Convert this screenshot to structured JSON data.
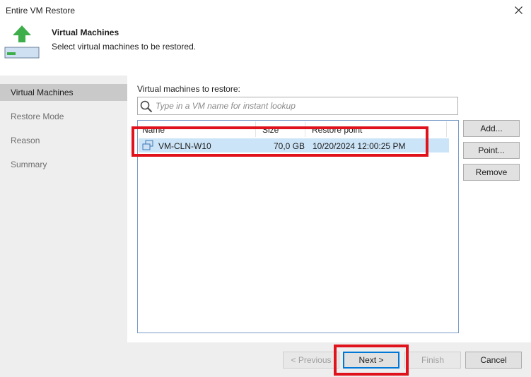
{
  "window": {
    "title": "Entire VM Restore"
  },
  "header": {
    "title": "Virtual Machines",
    "subtitle": "Select virtual machines to be restored."
  },
  "sidebar": {
    "items": [
      {
        "label": "Virtual Machines",
        "active": true
      },
      {
        "label": "Restore Mode",
        "active": false
      },
      {
        "label": "Reason",
        "active": false
      },
      {
        "label": "Summary",
        "active": false
      }
    ]
  },
  "main": {
    "section_label": "Virtual machines to restore:",
    "search": {
      "placeholder": "Type in a VM name for instant lookup",
      "value": ""
    },
    "table": {
      "columns": [
        "Name",
        "Size",
        "Restore point"
      ],
      "rows": [
        {
          "name": "VM-CLN-W10",
          "size": "70,0 GB",
          "restore_point": "10/20/2024 12:00:25 PM",
          "selected": true
        }
      ]
    },
    "side_buttons": {
      "add": "Add...",
      "point": "Point...",
      "remove": "Remove"
    }
  },
  "footer": {
    "previous": "< Previous",
    "next": "Next >",
    "finish": "Finish",
    "cancel": "Cancel"
  },
  "colors": {
    "highlight": "#e0121c",
    "selection": "#cce4f7",
    "focus": "#0078d7",
    "arrow": "#3dae4a"
  },
  "icons": {
    "close": "close-icon",
    "header": "restore-arrow-icon",
    "search": "search-icon",
    "vm": "vm-icon"
  }
}
